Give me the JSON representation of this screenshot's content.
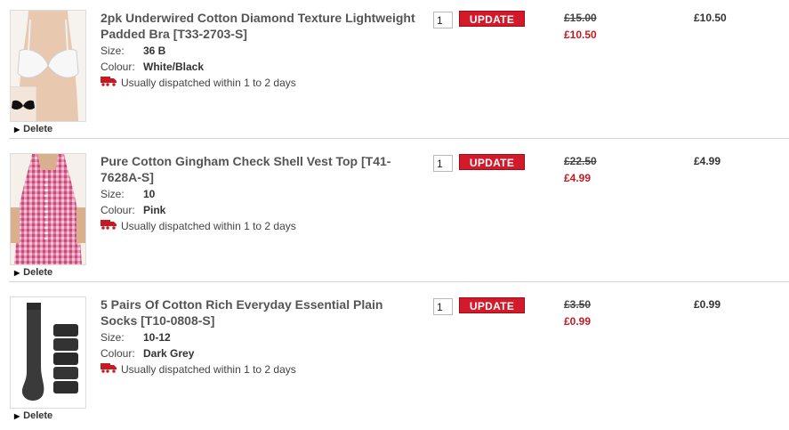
{
  "items": [
    {
      "title": "2pk Underwired Cotton Diamond Texture Lightweight Padded Bra [T33-2703-S]",
      "size_label": "Size:",
      "size": "36 B",
      "colour_label": "Colour:",
      "colour": "White/Black",
      "dispatch": "Usually dispatched within 1 to 2 days",
      "quantity": "1",
      "update_label": "UPDATE",
      "was_price": "£15.00",
      "now_price": "£10.50",
      "total": "£10.50",
      "delete_label": "Delete",
      "image": "bra-product-image"
    },
    {
      "title": "Pure Cotton Gingham Check Shell Vest Top [T41-7628A-S]",
      "size_label": "Size:",
      "size": "10",
      "colour_label": "Colour:",
      "colour": "Pink",
      "dispatch": "Usually dispatched within 1 to 2 days",
      "quantity": "1",
      "update_label": "UPDATE",
      "was_price": "£22.50",
      "now_price": "£4.99",
      "total": "£4.99",
      "delete_label": "Delete",
      "image": "vest-top-product-image"
    },
    {
      "title": "5 Pairs Of Cotton Rich Everyday Essential Plain Socks [T10-0808-S]",
      "size_label": "Size:",
      "size": "10-12",
      "colour_label": "Colour:",
      "colour": "Dark Grey",
      "dispatch": "Usually dispatched within 1 to 2 days",
      "quantity": "1",
      "update_label": "UPDATE",
      "was_price": "£3.50",
      "now_price": "£0.99",
      "total": "£0.99",
      "delete_label": "Delete",
      "image": "socks-product-image"
    }
  ],
  "colors": {
    "accent_red": "#d21a2a",
    "sale_price": "#c41a22",
    "text": "#444444",
    "divider": "#d4d4d4"
  }
}
